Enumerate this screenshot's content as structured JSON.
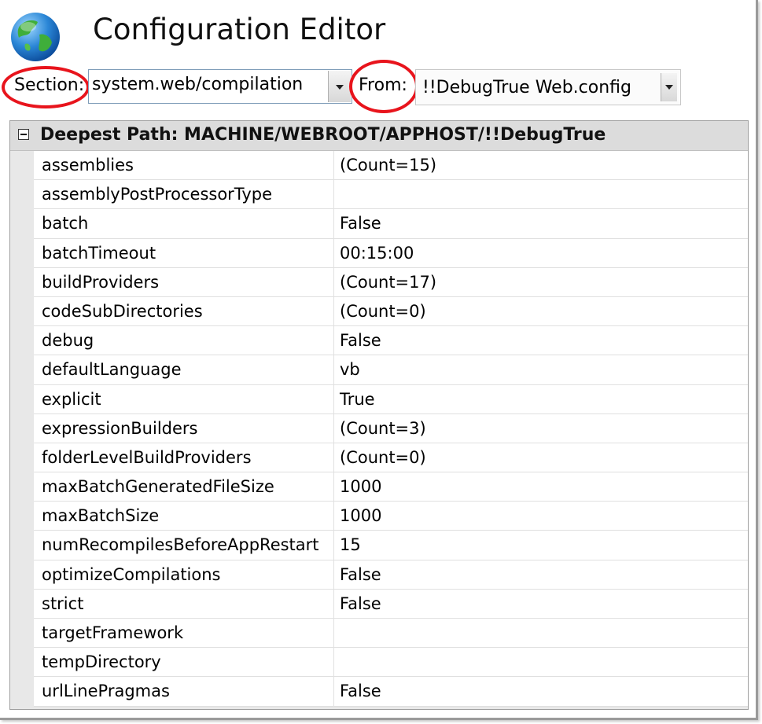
{
  "window": {
    "title": "Configuration Editor"
  },
  "toolbar": {
    "section_label": "Section:",
    "section_value": "system.web/compilation",
    "from_label": "From:",
    "from_value": "!!DebugTrue Web.config"
  },
  "grid": {
    "group_title": "Deepest Path: MACHINE/WEBROOT/APPHOST/!!DebugTrue",
    "rows": [
      {
        "name": "assemblies",
        "value": "(Count=15)"
      },
      {
        "name": "assemblyPostProcessorType",
        "value": ""
      },
      {
        "name": "batch",
        "value": "False"
      },
      {
        "name": "batchTimeout",
        "value": "00:15:00"
      },
      {
        "name": "buildProviders",
        "value": "(Count=17)"
      },
      {
        "name": "codeSubDirectories",
        "value": "(Count=0)"
      },
      {
        "name": "debug",
        "value": "False"
      },
      {
        "name": "defaultLanguage",
        "value": "vb"
      },
      {
        "name": "explicit",
        "value": "True"
      },
      {
        "name": "expressionBuilders",
        "value": "(Count=3)"
      },
      {
        "name": "folderLevelBuildProviders",
        "value": "(Count=0)"
      },
      {
        "name": "maxBatchGeneratedFileSize",
        "value": "1000"
      },
      {
        "name": "maxBatchSize",
        "value": "1000"
      },
      {
        "name": "numRecompilesBeforeAppRestart",
        "value": "15"
      },
      {
        "name": "optimizeCompilations",
        "value": "False"
      },
      {
        "name": "strict",
        "value": "False"
      },
      {
        "name": "targetFramework",
        "value": ""
      },
      {
        "name": "tempDirectory",
        "value": ""
      },
      {
        "name": "urlLinePragmas",
        "value": "False"
      }
    ]
  },
  "colors": {
    "annotation": "#e8141c",
    "group_header_bg": "#dcdcdc"
  },
  "icons": {
    "app_icon": "globe-icon",
    "dropdown_icon": "chevron-down-icon",
    "expander_icon": "collapse-icon"
  }
}
